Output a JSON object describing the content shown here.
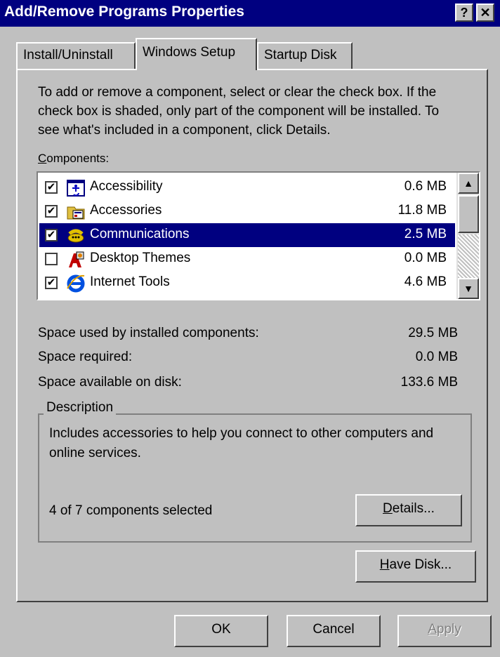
{
  "window": {
    "title": "Add/Remove Programs Properties",
    "help_button": "?",
    "close_button": "✕"
  },
  "tabs": [
    {
      "label": "Install/Uninstall",
      "active": false
    },
    {
      "label": "Windows Setup",
      "active": true
    },
    {
      "label": "Startup Disk",
      "active": false
    }
  ],
  "instructions": "To add or remove a component, select or clear the check box. If the check box is shaded, only part of the component will be installed. To see what's included in a component, click Details.",
  "components_label": "Components:",
  "components": [
    {
      "name": "Accessibility",
      "size": "0.6 MB",
      "checked": true,
      "selected": false,
      "icon": "accessibility-icon"
    },
    {
      "name": "Accessories",
      "size": "11.8 MB",
      "checked": true,
      "selected": false,
      "icon": "accessories-icon"
    },
    {
      "name": "Communications",
      "size": "2.5 MB",
      "checked": true,
      "selected": true,
      "icon": "communications-icon"
    },
    {
      "name": "Desktop Themes",
      "size": "0.0 MB",
      "checked": false,
      "selected": false,
      "icon": "desktop-themes-icon"
    },
    {
      "name": "Internet Tools",
      "size": "4.6 MB",
      "checked": true,
      "selected": false,
      "icon": "internet-explorer-icon"
    }
  ],
  "space": {
    "used_label": "Space used by installed components:",
    "used_value": "29.5 MB",
    "required_label": "Space required:",
    "required_value": "0.0 MB",
    "available_label": "Space available on disk:",
    "available_value": "133.6 MB"
  },
  "description": {
    "legend": "Description",
    "text": "Includes accessories to help you connect to other computers and online services.",
    "selected_count": "4 of 7 components selected"
  },
  "buttons": {
    "details": "Details...",
    "have_disk": "Have Disk...",
    "ok": "OK",
    "cancel": "Cancel",
    "apply": "Apply"
  },
  "colors": {
    "title_bar": "#000080",
    "face": "#c0c0c0",
    "selection": "#000080"
  }
}
